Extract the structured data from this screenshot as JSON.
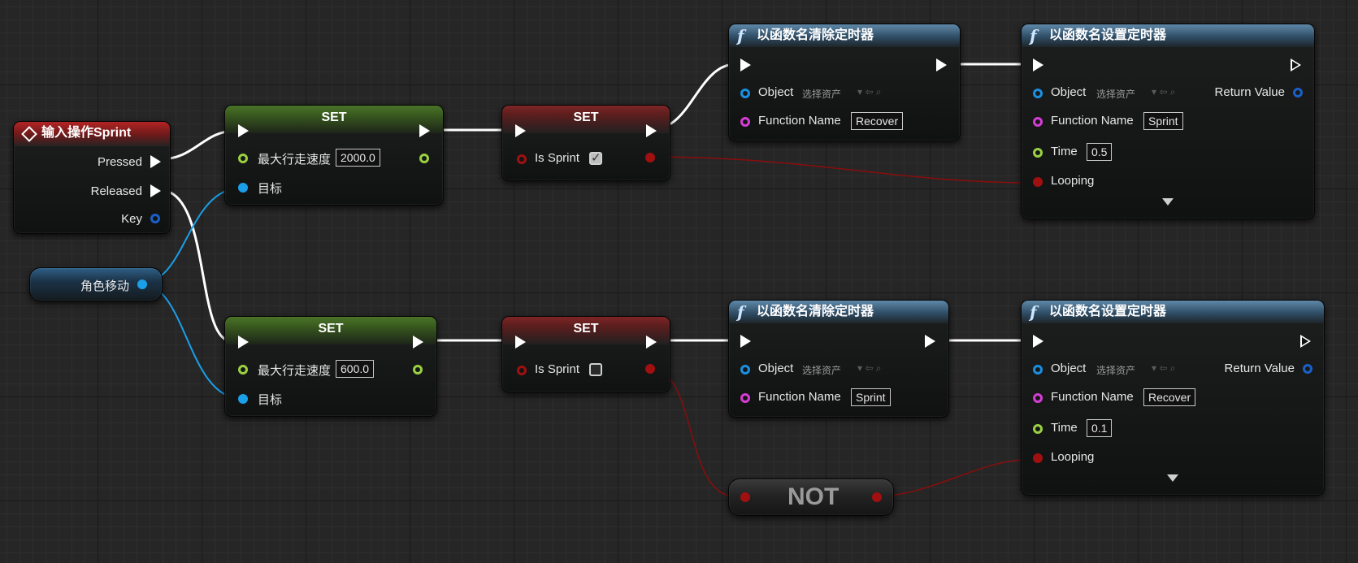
{
  "input_node": {
    "title": "输入操作Sprint",
    "pins": {
      "pressed": "Pressed",
      "released": "Released",
      "key": "Key"
    }
  },
  "variable_node": {
    "label": "角色移动"
  },
  "set_speed_top": {
    "title": "SET",
    "field_label": "最大行走速度",
    "value": "2000.0",
    "target": "目标"
  },
  "set_speed_bottom": {
    "title": "SET",
    "field_label": "最大行走速度",
    "value": "600.0",
    "target": "目标"
  },
  "set_sprint_top": {
    "title": "SET",
    "field_label": "Is Sprint",
    "checked": true
  },
  "set_sprint_bottom": {
    "title": "SET",
    "field_label": "Is Sprint",
    "checked": false
  },
  "clear_timer_top": {
    "title": "以函数名清除定时器",
    "object_label": "Object",
    "object_value": "选择资产",
    "function_label": "Function Name",
    "function_value": "Recover"
  },
  "clear_timer_bottom": {
    "title": "以函数名清除定时器",
    "object_label": "Object",
    "object_value": "选择资产",
    "function_label": "Function Name",
    "function_value": "Sprint"
  },
  "set_timer_top": {
    "title": "以函数名设置定时器",
    "object_label": "Object",
    "object_value": "选择资产",
    "function_label": "Function Name",
    "function_value": "Sprint",
    "time_label": "Time",
    "time_value": "0.5",
    "looping_label": "Looping",
    "return_label": "Return Value"
  },
  "set_timer_bottom": {
    "title": "以函数名设置定时器",
    "object_label": "Object",
    "object_value": "选择资产",
    "function_label": "Function Name",
    "function_value": "Recover",
    "time_label": "Time",
    "time_value": "0.1",
    "looping_label": "Looping",
    "return_label": "Return Value"
  },
  "not_node": {
    "label": "NOT"
  },
  "colors": {
    "exec_wire": "#ffffff",
    "object_wire": "#1a9fe8",
    "bool_wire": "#8a0d0d",
    "float_pin": "#9ad042",
    "name_pin": "#d63cd6"
  }
}
